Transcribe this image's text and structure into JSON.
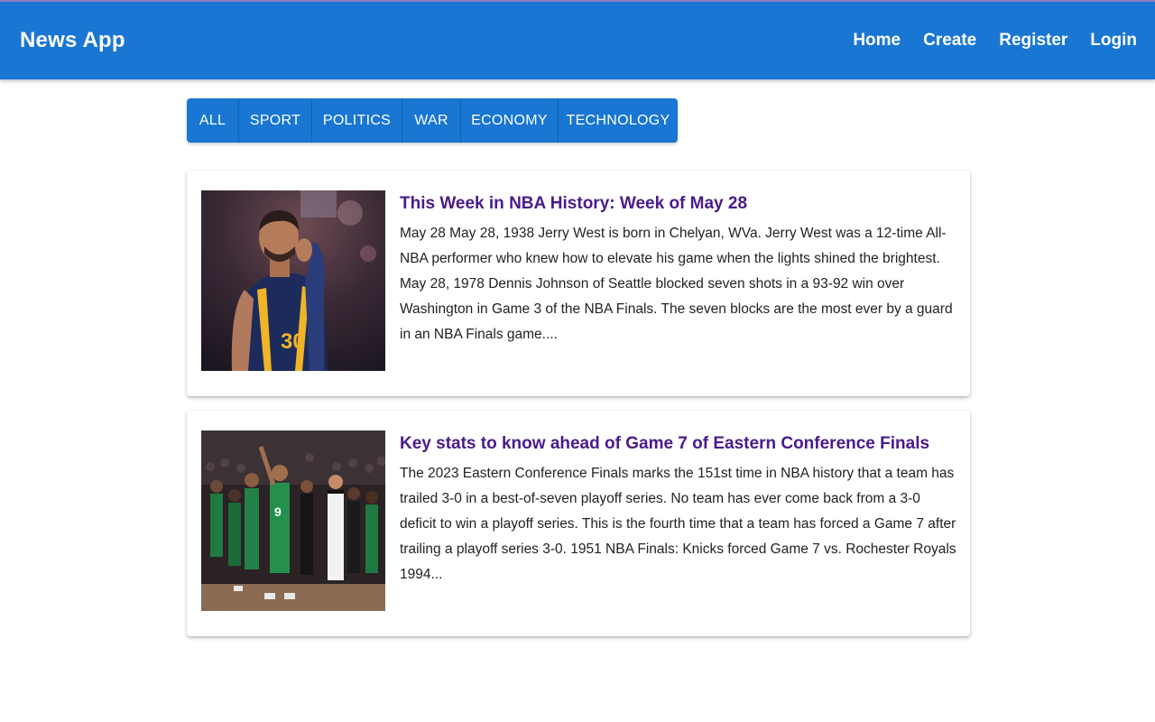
{
  "header": {
    "brand": "News App",
    "nav": [
      "Home",
      "Create",
      "Register",
      "Login"
    ]
  },
  "categories": [
    "ALL",
    "SPORT",
    "POLITICS",
    "WAR",
    "ECONOMY",
    "TECHNOLOGY"
  ],
  "articles": [
    {
      "title": "This Week in NBA History: Week of May 28",
      "excerpt": "May 28 May 28, 1938 Jerry West is born in Chelyan, WVa. Jerry West was a 12-time All-NBA performer who knew how to elevate his game when the lights shined the brightest. May 28, 1978 Dennis Johnson of Seattle blocked seven shots in a 93-92 win over Washington in Game 3 of the NBA Finals. The seven blocks are the most ever by a guard in an NBA Finals game....",
      "jersey_number": "30"
    },
    {
      "title": "Key stats to know ahead of Game 7 of Eastern Conference Finals",
      "excerpt": "The 2023 Eastern Conference Finals marks the 151st time in NBA history that a team has trailed 3-0 in a best-of-seven playoff series. No team has ever come back from a 3-0 deficit to win a playoff series. This is the fourth time that a team has forced a Game 7 after trailing a playoff series 3-0. 1951 NBA Finals: Knicks forced Game 7 vs. Rochester Royals 1994...",
      "jersey_number": "9"
    }
  ],
  "colors": {
    "primary": "#1976d2",
    "title": "#4a1a8c",
    "text": "#222222"
  }
}
